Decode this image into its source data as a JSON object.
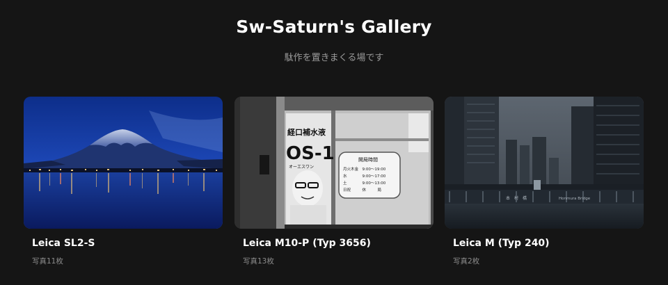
{
  "header": {
    "title": "Sw-Saturn's Gallery",
    "subtitle": "駄作を置きまくる場です"
  },
  "albums": [
    {
      "name": "Leica SL2-S",
      "count": "写真11枚"
    },
    {
      "name": "Leica M10-P (Typ 3656)",
      "count": "写真13枚"
    },
    {
      "name": "Leica M (Typ 240)",
      "count": "写真2枚"
    }
  ],
  "photo_text": {
    "sign_top": "経口補水液",
    "sign_big": "OS-1",
    "sign_small": "オーエスワン",
    "hours_title": "開局時間",
    "hours_rows": [
      "月火木金　9:00〜19:00",
      "水　　　　9:00〜17:00",
      "土　　　　9:00〜13:00",
      "日祝　　　休　　　局"
    ],
    "bridge_left": "本　村　橋",
    "bridge_right": "Honmura  Bridge"
  },
  "colors": {
    "background": "#151515",
    "title": "#ffffff",
    "muted": "#8c8c8c"
  }
}
